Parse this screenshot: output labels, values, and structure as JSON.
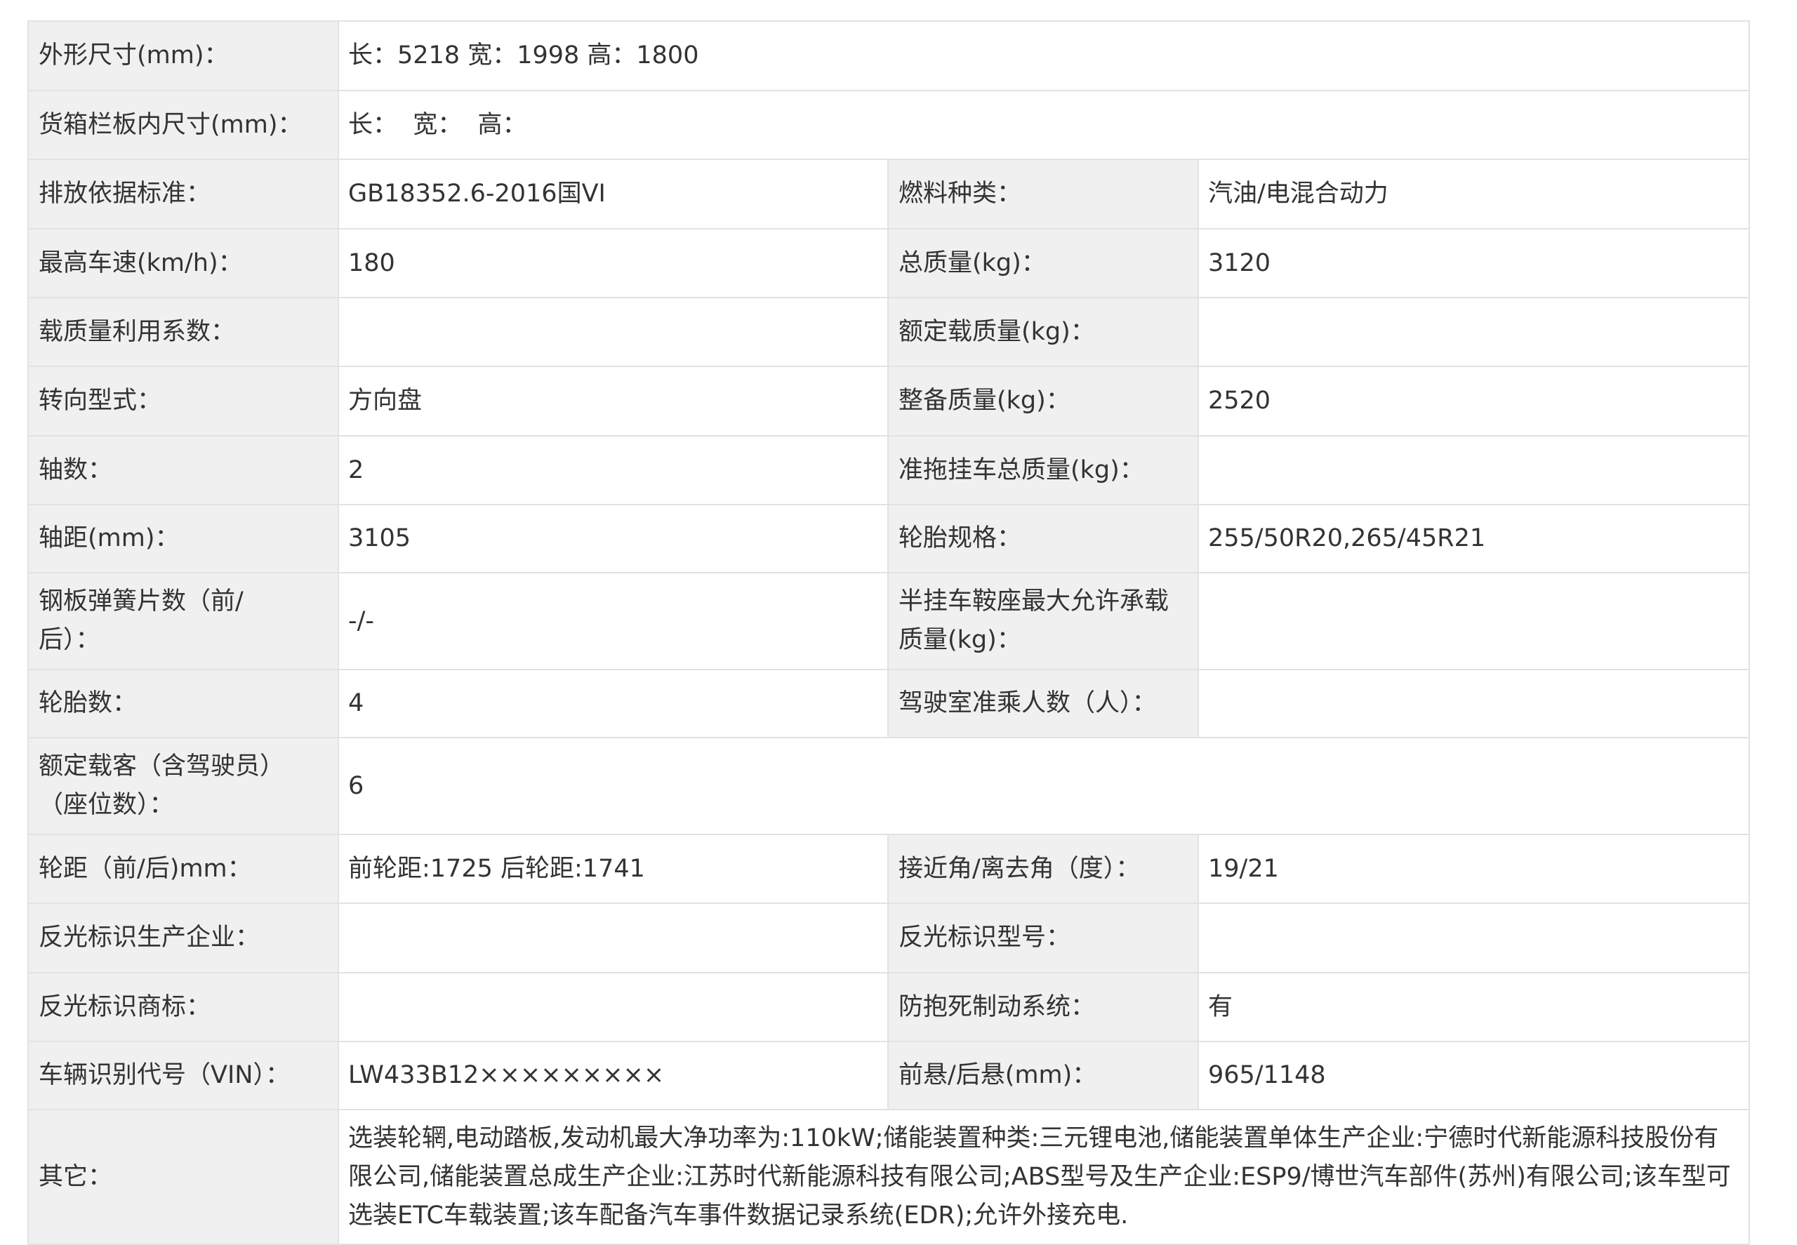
{
  "rows": [
    {
      "label": "外形尺寸(mm)：",
      "value": "长：5218 宽：1998 高：1800"
    },
    {
      "label": "货箱栏板内尺寸(mm)：",
      "value": "长：  宽：  高："
    },
    {
      "label": "排放依据标准：",
      "value": "GB18352.6-2016国VI",
      "label2": "燃料种类：",
      "value2": "汽油/电混合动力"
    },
    {
      "label": "最高车速(km/h)：",
      "value": "180",
      "label2": "总质量(kg)：",
      "value2": "3120"
    },
    {
      "label": "载质量利用系数：",
      "value": "",
      "label2": "额定载质量(kg)：",
      "value2": ""
    },
    {
      "label": "转向型式：",
      "value": "方向盘",
      "label2": "整备质量(kg)：",
      "value2": "2520"
    },
    {
      "label": "轴数：",
      "value": "2",
      "label2": "准拖挂车总质量(kg)：",
      "value2": ""
    },
    {
      "label": "轴距(mm)：",
      "value": "3105",
      "label2": "轮胎规格：",
      "value2": "255/50R20,265/45R21"
    },
    {
      "label": "钢板弹簧片数（前/\n后）：",
      "value": "-/-",
      "label2": "半挂车鞍座最大允许承载\n质量(kg)：",
      "value2": ""
    },
    {
      "label": "轮胎数：",
      "value": "4",
      "label2": "驾驶室准乘人数（人）：",
      "value2": ""
    },
    {
      "label": "额定载客（含驾驶员）\n（座位数）：",
      "value": "6"
    },
    {
      "label": "轮距（前/后)mm：",
      "value": "前轮距:1725 后轮距:1741",
      "label2": "接近角/离去角（度）：",
      "value2": "19/21"
    },
    {
      "label": "反光标识生产企业：",
      "value": "",
      "label2": "反光标识型号：",
      "value2": ""
    },
    {
      "label": "反光标识商标：",
      "value": "",
      "label2": "防抱死制动系统：",
      "value2": "有"
    },
    {
      "label": "车辆识别代号（VIN）：",
      "value": "LW433B12×××××××××",
      "label2": "前悬/后悬(mm)：",
      "value2": "965/1148"
    },
    {
      "label": "其它：",
      "value": "选装轮辋,电动踏板,发动机最大净功率为:110kW;储能装置种类:三元锂电池,储能装置单体生产企业:宁德时代新能源科技股份有限公司,储能装置总成生产企业:江苏时代新能源科技有限公司;ABS型号及生产企业:ESP9/博世汽车部件(苏州)有限公司;该车型可选装ETC车载装置;该车配备汽车事件数据记录系统(EDR);允许外接充电."
    }
  ]
}
